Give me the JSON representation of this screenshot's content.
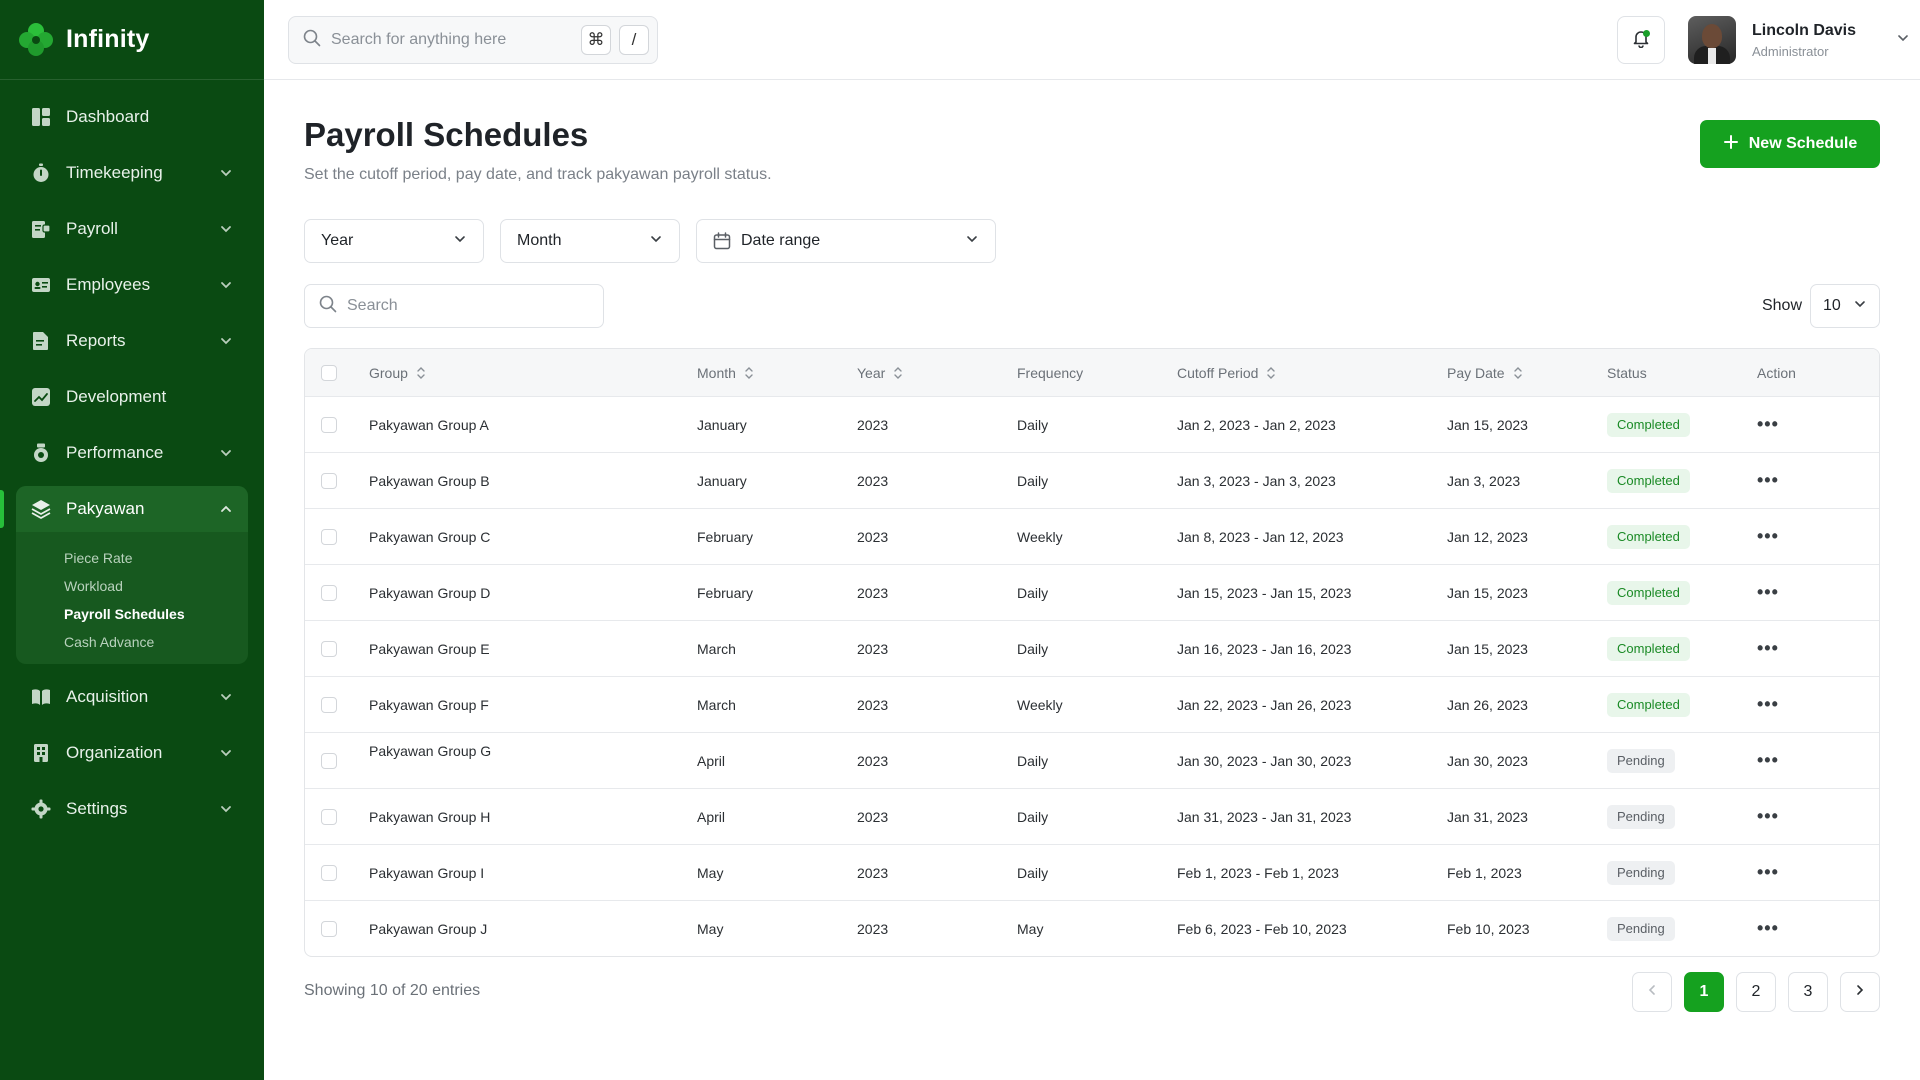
{
  "brand": {
    "name": "Infinity",
    "accent": "#15a11f",
    "sidebar_bg": "#0a4a12"
  },
  "sidebar": {
    "items": [
      {
        "label": "Dashboard",
        "icon": "dashboard-icon",
        "expandable": false
      },
      {
        "label": "Timekeeping",
        "icon": "stopwatch-icon",
        "expandable": true
      },
      {
        "label": "Payroll",
        "icon": "payroll-icon",
        "expandable": true
      },
      {
        "label": "Employees",
        "icon": "id-card-icon",
        "expandable": true
      },
      {
        "label": "Reports",
        "icon": "report-icon",
        "expandable": true
      },
      {
        "label": "Development",
        "icon": "chart-icon",
        "expandable": false
      },
      {
        "label": "Performance",
        "icon": "performance-icon",
        "expandable": true
      },
      {
        "label": "Pakyawan",
        "icon": "layers-icon",
        "expandable": true,
        "expanded": true
      },
      {
        "label": "Acquisition",
        "icon": "book-icon",
        "expandable": true
      },
      {
        "label": "Organization",
        "icon": "building-icon",
        "expandable": true
      },
      {
        "label": "Settings",
        "icon": "gear-icon",
        "expandable": true
      }
    ],
    "pakyawan_sub": [
      "Piece Rate",
      "Workload",
      "Payroll Schedules",
      "Cash Advance"
    ]
  },
  "topbar": {
    "search_placeholder": "Search for anything here",
    "shortcut_key1": "⌘",
    "shortcut_key2": "/",
    "user_name": "Lincoln Davis",
    "user_role": "Administrator"
  },
  "page": {
    "title": "Payroll Schedules",
    "subtitle": "Set the cutoff period, pay date, and track pakyawan payroll status.",
    "new_button": "New Schedule"
  },
  "filters": {
    "year": "Year",
    "month": "Month",
    "date_range": "Date range",
    "search_placeholder": "Search",
    "show_label": "Show",
    "show_value": "10"
  },
  "table": {
    "headers": {
      "group": "Group",
      "month": "Month",
      "year": "Year",
      "frequency": "Frequency",
      "cutoff": "Cutoff Period",
      "pay_date": "Pay Date",
      "status": "Status",
      "action": "Action"
    },
    "rows": [
      {
        "group": "Pakyawan Group A",
        "month": "January",
        "year": "2023",
        "frequency": "Daily",
        "cutoff": "Jan 2, 2023 - Jan 2, 2023",
        "pay_date": "Jan 15, 2023",
        "status": "Completed"
      },
      {
        "group": "Pakyawan Group B",
        "month": "January",
        "year": "2023",
        "frequency": "Daily",
        "cutoff": "Jan 3, 2023 - Jan 3, 2023",
        "pay_date": "Jan 3, 2023",
        "status": "Completed"
      },
      {
        "group": "Pakyawan Group C",
        "month": "February",
        "year": "2023",
        "frequency": "Weekly",
        "cutoff": "Jan 8, 2023 - Jan 12, 2023",
        "pay_date": "Jan 12, 2023",
        "status": "Completed"
      },
      {
        "group": "Pakyawan Group D",
        "month": "February",
        "year": "2023",
        "frequency": "Daily",
        "cutoff": "Jan 15, 2023 - Jan 15, 2023",
        "pay_date": "Jan 15, 2023",
        "status": "Completed"
      },
      {
        "group": "Pakyawan Group E",
        "month": "March",
        "year": "2023",
        "frequency": "Daily",
        "cutoff": "Jan 16, 2023 - Jan 16, 2023",
        "pay_date": "Jan 15, 2023",
        "status": "Completed"
      },
      {
        "group": "Pakyawan Group F",
        "month": "March",
        "year": "2023",
        "frequency": "Weekly",
        "cutoff": "Jan 22, 2023 - Jan 26, 2023",
        "pay_date": "Jan 26, 2023",
        "status": "Completed"
      },
      {
        "group": "Pakyawan Group G",
        "month": "April",
        "year": "2023",
        "frequency": "Daily",
        "cutoff": "Jan 30, 2023 - Jan 30, 2023",
        "pay_date": "Jan 30, 2023",
        "status": "Pending"
      },
      {
        "group": "Pakyawan Group H",
        "month": "April",
        "year": "2023",
        "frequency": "Daily",
        "cutoff": "Jan 31, 2023 - Jan 31, 2023",
        "pay_date": "Jan 31, 2023",
        "status": "Pending"
      },
      {
        "group": "Pakyawan Group I",
        "month": "May",
        "year": "2023",
        "frequency": "Daily",
        "cutoff": "Feb 1, 2023 - Feb 1, 2023",
        "pay_date": "Feb 1, 2023",
        "status": "Pending"
      },
      {
        "group": "Pakyawan Group J",
        "month": "May",
        "year": "2023",
        "frequency": "May",
        "cutoff": "Feb 6, 2023 - Feb 10, 2023",
        "pay_date": "Feb 10, 2023",
        "status": "Pending"
      }
    ],
    "action_glyph": "•••"
  },
  "footer": {
    "showing": "Showing 10 of 20 entries",
    "pages": [
      "1",
      "2",
      "3"
    ],
    "current_page": "1"
  }
}
